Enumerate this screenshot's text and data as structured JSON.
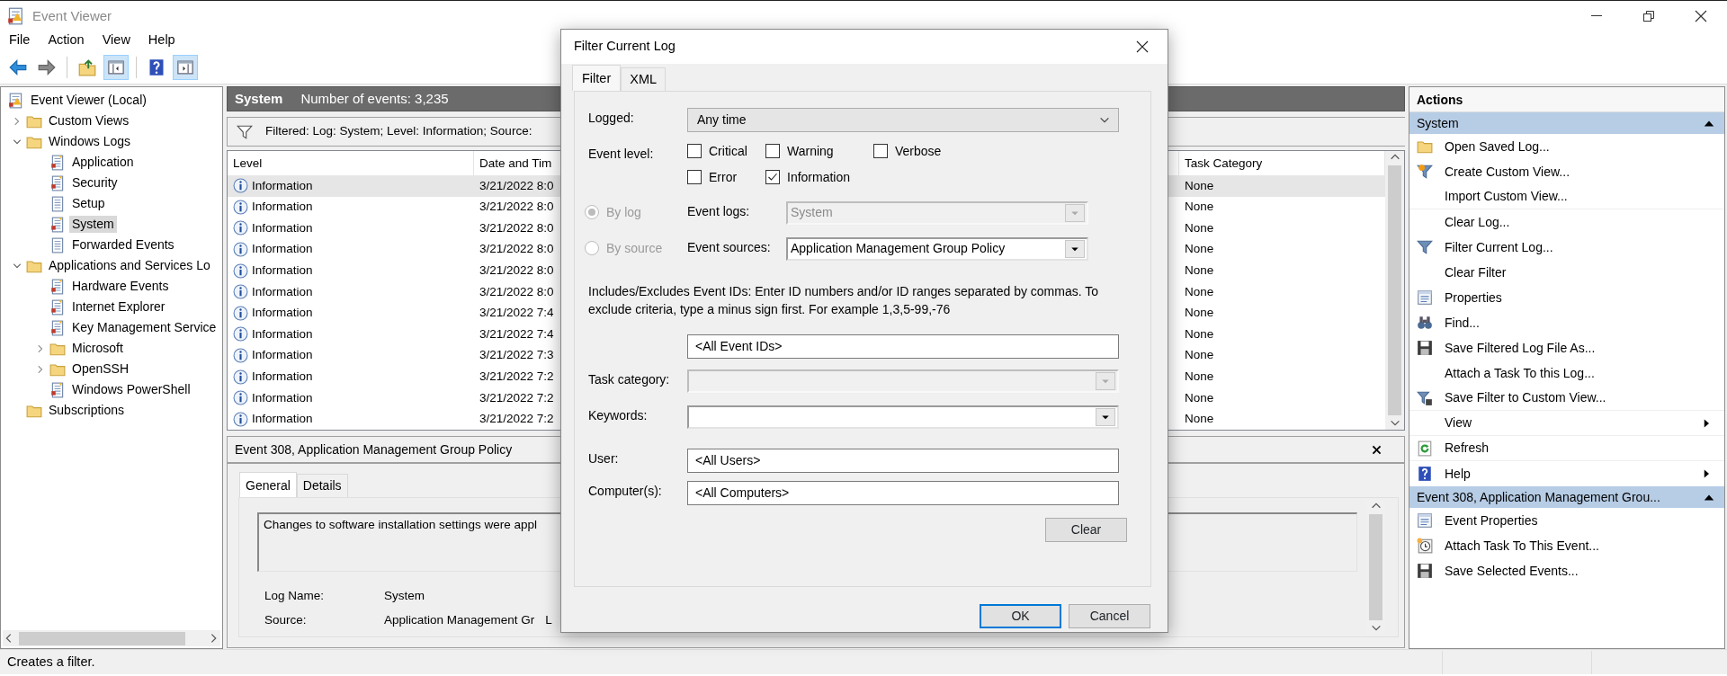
{
  "window": {
    "title": "Event Viewer"
  },
  "menu": [
    "File",
    "Action",
    "View",
    "Help"
  ],
  "tree": [
    {
      "label": "Event Viewer (Local)",
      "kind": "root",
      "selected": false,
      "children": [
        {
          "label": "Custom Views",
          "kind": "folder",
          "expanded": false,
          "selected": false
        },
        {
          "label": "Windows Logs",
          "kind": "folder",
          "expanded": true,
          "selected": false,
          "children": [
            {
              "label": "Application",
              "kind": "log",
              "selected": false
            },
            {
              "label": "Security",
              "kind": "log",
              "selected": false
            },
            {
              "label": "Setup",
              "kind": "plainlog",
              "selected": false
            },
            {
              "label": "System",
              "kind": "log",
              "selected": true
            },
            {
              "label": "Forwarded Events",
              "kind": "plainlog",
              "selected": false
            }
          ]
        },
        {
          "label": "Applications and Services Lo",
          "kind": "folder",
          "expanded": true,
          "selected": false,
          "children": [
            {
              "label": "Hardware Events",
              "kind": "log",
              "selected": false
            },
            {
              "label": "Internet Explorer",
              "kind": "log",
              "selected": false
            },
            {
              "label": "Key Management Service",
              "kind": "log",
              "selected": false
            },
            {
              "label": "Microsoft",
              "kind": "folder",
              "expanded": false,
              "selected": false
            },
            {
              "label": "OpenSSH",
              "kind": "folder",
              "expanded": false,
              "selected": false
            },
            {
              "label": "Windows PowerShell",
              "kind": "log",
              "selected": false
            }
          ]
        },
        {
          "label": "Subscriptions",
          "kind": "folder",
          "selected": false
        }
      ]
    }
  ],
  "center": {
    "title": "System",
    "count": "Number of events: 3,235",
    "filter": "Filtered: Log: System; Level: Information; Source:",
    "table": {
      "columns": [
        "Level",
        "Date and Tim",
        "Task Category"
      ],
      "rows": [
        {
          "level": "Information",
          "date": "3/21/2022 8:0",
          "task_category": "None",
          "selected": true
        },
        {
          "level": "Information",
          "date": "3/21/2022 8:0",
          "task_category": "None",
          "selected": false
        },
        {
          "level": "Information",
          "date": "3/21/2022 8:0",
          "task_category": "None",
          "selected": false
        },
        {
          "level": "Information",
          "date": "3/21/2022 8:0",
          "task_category": "None",
          "selected": false
        },
        {
          "level": "Information",
          "date": "3/21/2022 8:0",
          "task_category": "None",
          "selected": false
        },
        {
          "level": "Information",
          "date": "3/21/2022 8:0",
          "task_category": "None",
          "selected": false
        },
        {
          "level": "Information",
          "date": "3/21/2022 7:4",
          "task_category": "None",
          "selected": false
        },
        {
          "level": "Information",
          "date": "3/21/2022 7:4",
          "task_category": "None",
          "selected": false
        },
        {
          "level": "Information",
          "date": "3/21/2022 7:3",
          "task_category": "None",
          "selected": false
        },
        {
          "level": "Information",
          "date": "3/21/2022 7:2",
          "task_category": "None",
          "selected": false
        },
        {
          "level": "Information",
          "date": "3/21/2022 7:2",
          "task_category": "None",
          "selected": false
        },
        {
          "level": "Information",
          "date": "3/21/2022 7:2",
          "task_category": "None",
          "selected": false
        }
      ]
    },
    "detail": {
      "title": "Event 308, Application Management Group Policy",
      "tabs": [
        {
          "label": "General",
          "selected": true
        },
        {
          "label": "Details",
          "selected": false
        }
      ],
      "message": "Changes to software installation settings were appl",
      "fields": [
        {
          "label": "Log Name:",
          "value": "System"
        },
        {
          "label": "Source:",
          "value": "Application Management Gr",
          "column_3": "L"
        }
      ]
    }
  },
  "actions": {
    "title": "Actions",
    "sections": [
      {
        "title": "System",
        "expanded": true,
        "items": [
          {
            "label": "Open Saved Log..."
          },
          {
            "label": "Create Custom View..."
          },
          {
            "label": "Import Custom View...",
            "divider_after": true
          },
          {
            "label": "Clear Log..."
          },
          {
            "label": "Filter Current Log..."
          },
          {
            "label": "Clear Filter"
          },
          {
            "label": "Properties"
          },
          {
            "label": "Find..."
          },
          {
            "label": "Save Filtered Log File As..."
          },
          {
            "label": "Attach a Task To this Log..."
          },
          {
            "label": "Save Filter to Custom View...",
            "divider_after": true
          },
          {
            "label": "View",
            "submenu": true,
            "divider_after": true
          },
          {
            "label": "Refresh",
            "divider_after": true
          },
          {
            "label": "Help",
            "submenu": true
          }
        ]
      },
      {
        "title": "Event 308, Application Management Grou...",
        "expanded": true,
        "items": [
          {
            "label": "Event Properties"
          },
          {
            "label": "Attach Task To This Event..."
          },
          {
            "label": "Save Selected Events..."
          }
        ]
      }
    ]
  },
  "status_bar": "Creates a filter.",
  "dialog": {
    "title": "Filter Current Log",
    "tabs": [
      {
        "label": "Filter",
        "selected": true
      },
      {
        "label": "XML",
        "selected": false
      }
    ],
    "logged": {
      "label": "Logged:",
      "value": "Any time"
    },
    "event_level": {
      "label": "Event level:",
      "options": [
        {
          "label": "Critical",
          "checked": false
        },
        {
          "label": "Warning",
          "checked": false
        },
        {
          "label": "Verbose",
          "checked": false
        },
        {
          "label": "Error",
          "checked": false
        },
        {
          "label": "Information",
          "checked": true
        }
      ]
    },
    "scope": [
      {
        "label": "By log",
        "selected": true,
        "disabled": true,
        "field_label": "Event logs:",
        "value": "System",
        "field_disabled": true
      },
      {
        "label": "By source",
        "selected": false,
        "disabled": true,
        "field_label": "Event sources:",
        "value": "Application Management Group Policy",
        "field_disabled": false
      }
    ],
    "event_ids": {
      "help": "Includes/Excludes Event IDs: Enter ID numbers and/or ID ranges separated by commas. To exclude criteria, type a minus sign first. For example 1,3,5-99,-76",
      "value": "<All Event IDs>"
    },
    "task_category": {
      "label": "Task category:",
      "disabled": true
    },
    "keywords": {
      "label": "Keywords:",
      "disabled": false
    },
    "user": {
      "label": "User:",
      "value": "<All Users>"
    },
    "computer": {
      "label": "Computer(s):",
      "value": "<All Computers>"
    },
    "clear_button": "Clear",
    "buttons": [
      {
        "label": "OK",
        "default": true
      },
      {
        "label": "Cancel",
        "default": false
      }
    ]
  }
}
